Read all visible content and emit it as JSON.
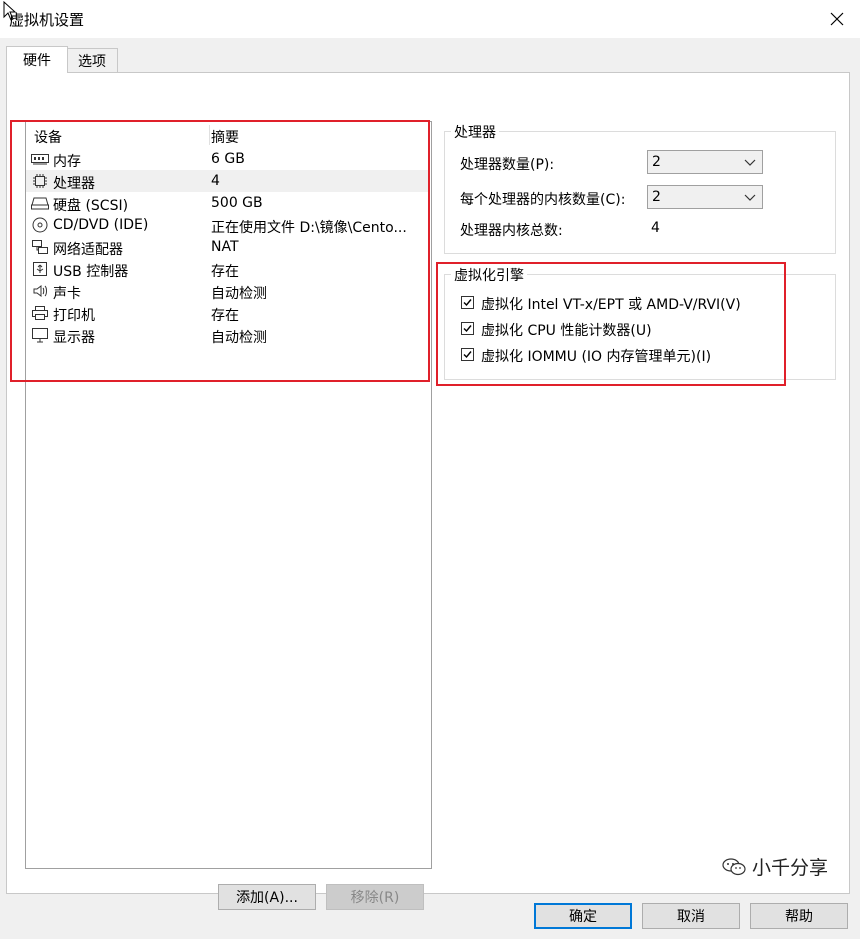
{
  "window": {
    "title": "虚拟机设置"
  },
  "tabs": [
    {
      "label": "硬件",
      "active": true
    },
    {
      "label": "选项",
      "active": false
    }
  ],
  "device_list": {
    "headers": {
      "device": "设备",
      "summary": "摘要"
    },
    "rows": [
      {
        "icon": "memory-icon",
        "name": "内存",
        "summary": "6 GB",
        "selected": false
      },
      {
        "icon": "processor-icon",
        "name": "处理器",
        "summary": "4",
        "selected": true
      },
      {
        "icon": "hard-disk-icon",
        "name": "硬盘 (SCSI)",
        "summary": "500 GB",
        "selected": false
      },
      {
        "icon": "cd-dvd-icon",
        "name": "CD/DVD (IDE)",
        "summary": "正在使用文件 D:\\镜像\\Cento...",
        "selected": false
      },
      {
        "icon": "network-adapter-icon",
        "name": "网络适配器",
        "summary": "NAT",
        "selected": false
      },
      {
        "icon": "usb-icon",
        "name": "USB 控制器",
        "summary": "存在",
        "selected": false
      },
      {
        "icon": "sound-card-icon",
        "name": "声卡",
        "summary": "自动检测",
        "selected": false
      },
      {
        "icon": "printer-icon",
        "name": "打印机",
        "summary": "存在",
        "selected": false
      },
      {
        "icon": "display-icon",
        "name": "显示器",
        "summary": "自动检测",
        "selected": false
      }
    ]
  },
  "list_buttons": {
    "add": "添加(A)...",
    "remove": "移除(R)"
  },
  "processor": {
    "group_title": "处理器",
    "count_label": "处理器数量(P):",
    "count_value": "2",
    "cores_label": "每个处理器的内核数量(C):",
    "cores_value": "2",
    "total_label": "处理器内核总数:",
    "total_value": "4"
  },
  "virtualization": {
    "group_title": "虚拟化引擎",
    "options": [
      {
        "label": "虚拟化 Intel VT-x/EPT 或 AMD-V/RVI(V)",
        "checked": true
      },
      {
        "label": "虚拟化 CPU 性能计数器(U)",
        "checked": true
      },
      {
        "label": "虚拟化 IOMMU (IO 内存管理单元)(I)",
        "checked": true
      }
    ]
  },
  "dialog_buttons": {
    "ok": "确定",
    "cancel": "取消",
    "help": "帮助"
  },
  "watermark": {
    "text": "小千分享"
  },
  "colors": {
    "highlight_box": "#e0202a",
    "default_button_border": "#0078d7"
  }
}
